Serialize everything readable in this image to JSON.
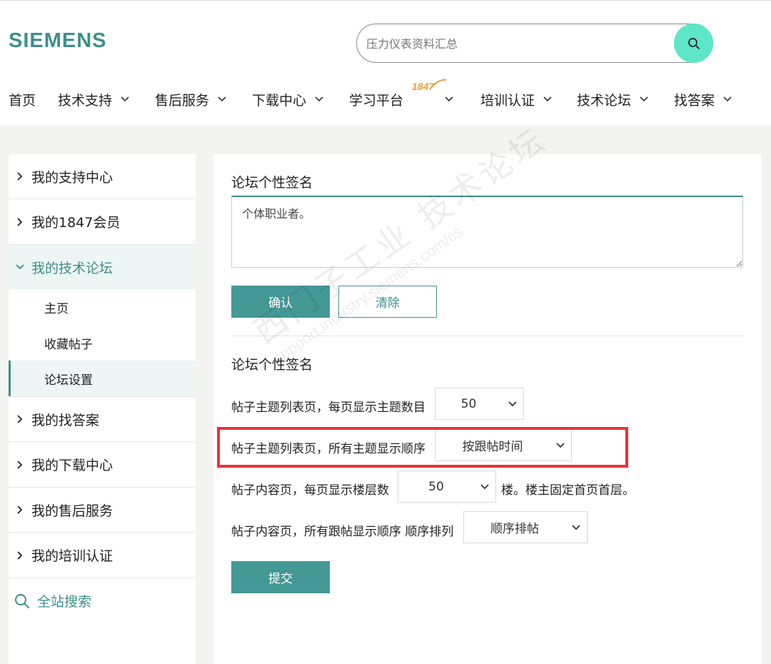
{
  "header": {
    "logo": "SIEMENS",
    "search_placeholder": "压力仪表资料汇总",
    "nav": [
      {
        "label": "首页",
        "has_dropdown": false
      },
      {
        "label": "技术支持",
        "has_dropdown": true
      },
      {
        "label": "售后服务",
        "has_dropdown": true
      },
      {
        "label": "下载中心",
        "has_dropdown": true
      },
      {
        "label": "学习平台",
        "has_dropdown": true
      },
      {
        "label": "培训认证",
        "has_dropdown": true
      },
      {
        "label": "技术论坛",
        "has_dropdown": true
      },
      {
        "label": "找答案",
        "has_dropdown": true
      }
    ],
    "learning_badge": "1847"
  },
  "sidebar": {
    "items": [
      {
        "label": "我的支持中心"
      },
      {
        "label": "我的1847会员"
      },
      {
        "label": "我的技术论坛",
        "expanded": true
      },
      {
        "label": "我的找答案"
      },
      {
        "label": "我的下载中心"
      },
      {
        "label": "我的售后服务"
      },
      {
        "label": "我的培训认证"
      }
    ],
    "forum_subitems": [
      {
        "label": "主页"
      },
      {
        "label": "收藏帖子"
      },
      {
        "label": "论坛设置",
        "current": true
      }
    ],
    "site_search": "全站搜索"
  },
  "main": {
    "signature_title": "论坛个性签名",
    "signature_value": "个体职业者。",
    "confirm_label": "确认",
    "clear_label": "清除",
    "settings_title": "论坛个性签名",
    "settings": [
      {
        "label": "帖子主题列表页，每页显示主题数目",
        "value": "50",
        "suffix": ""
      },
      {
        "label": "帖子主题列表页，所有主题显示顺序",
        "value": "按跟帖时间",
        "suffix": ""
      },
      {
        "label": "帖子内容页，每页显示楼层数",
        "value": "50",
        "suffix": "楼。楼主固定首页首层。"
      },
      {
        "label": "帖子内容页，所有跟帖显示顺序 顺序排列",
        "value": "顺序排帖",
        "suffix": ""
      }
    ],
    "submit_label": "提交"
  },
  "watermark": {
    "text": "西门子工业 技术论坛",
    "url": "support.industry.siemens.com/cs"
  },
  "colors": {
    "brand": "#3d8f8c",
    "button": "#449896",
    "search_button": "#5ee6c8",
    "highlight": "#e8333d",
    "badge": "#e7a13b"
  }
}
